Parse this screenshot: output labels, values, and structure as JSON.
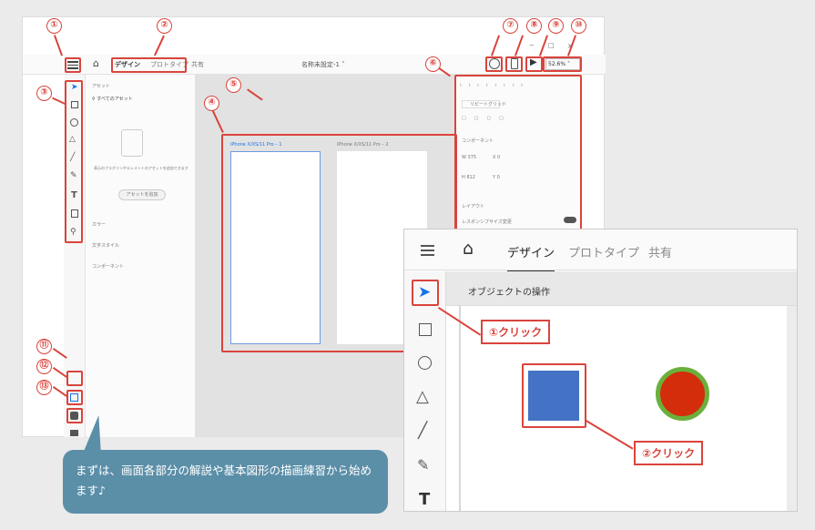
{
  "left": {
    "tabs": [
      "デザイン",
      "プロトタイプ",
      "共有"
    ],
    "doc_title": "名称未設定-1",
    "zoom": "52.6%",
    "window_controls": [
      "−",
      "□",
      "×"
    ],
    "assets": {
      "title": "アセット",
      "search": "すべてのアセット",
      "empty_text": "表示のプラグインやエレメントのアセットを追加できます",
      "add_button": "アセットを追加",
      "sections": [
        "カラー",
        "文字スタイル",
        "コンポーネント"
      ]
    },
    "artboards": [
      "iPhone X/XS/11 Pro – 1",
      "iPhone X/XS/11 Pro – 2"
    ],
    "props": {
      "repeat_grid": "リピートグリッド",
      "component": "コンポーネント",
      "w": "W 375",
      "h": "H 812",
      "x": "X 0",
      "y": "Y 0",
      "layout": "レイアウト",
      "responsive": "レスポンシブサイズ変更"
    },
    "callouts": [
      "①",
      "②",
      "③",
      "④",
      "⑤",
      "⑥",
      "⑦",
      "⑧",
      "⑨",
      "⑩",
      "⑪",
      "⑫",
      "⑬"
    ]
  },
  "bubble": {
    "text": "まずは、画面各部分の解説や基本図形の描画練習から始めます♪"
  },
  "zoom_panel": {
    "tabs": [
      "デザイン",
      "プロトタイプ",
      "共有"
    ],
    "header": "オブジェクトの操作",
    "label1": "①クリック",
    "label2": "②クリック"
  },
  "colors": {
    "accent": "#d9443c",
    "bubble": "#5b8fa8",
    "blue_square": "#4472c4",
    "red_circle": "#d32d0c",
    "green_ring": "#6ab03a"
  }
}
